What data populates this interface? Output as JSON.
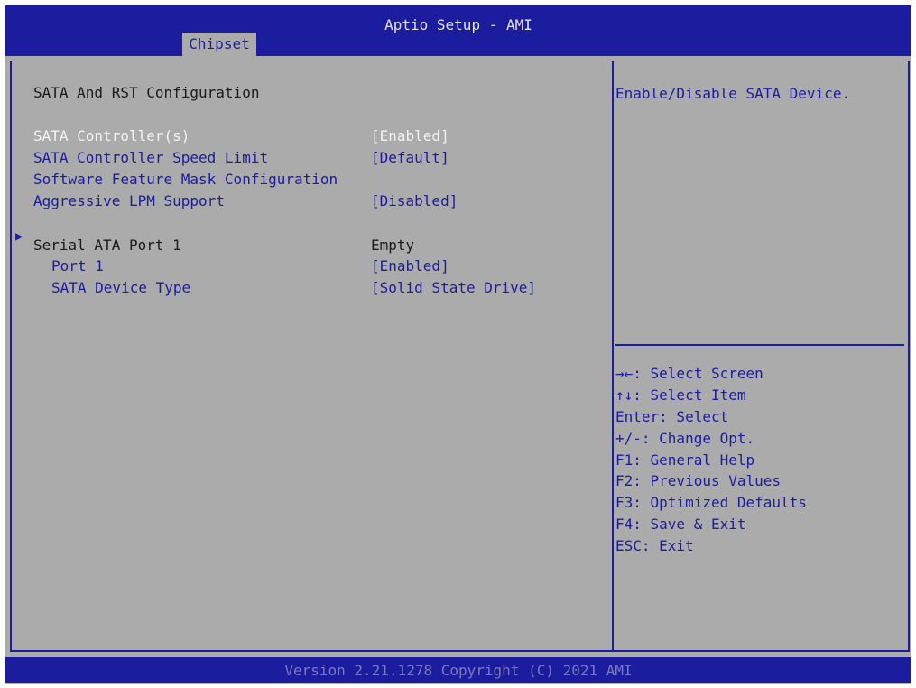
{
  "header": {
    "title": "Aptio Setup - AMI",
    "tab": "Chipset"
  },
  "page_title": "SATA And RST Configuration",
  "items": [
    {
      "label": "SATA Controller(s)",
      "value": "[Enabled]"
    },
    {
      "label": "SATA Controller Speed Limit",
      "value": "[Default]"
    },
    {
      "label": "Software Feature Mask Configuration",
      "value": ""
    },
    {
      "label": "Aggressive LPM Support",
      "value": "[Disabled]"
    }
  ],
  "port_section": {
    "label": "Serial ATA Port 1",
    "value": "Empty"
  },
  "port_items": [
    {
      "label": "Port 1",
      "value": "[Enabled]"
    },
    {
      "label": "SATA Device Type",
      "value": "[Solid State Drive]"
    }
  ],
  "help_text": "Enable/Disable SATA Device.",
  "key_help": [
    "→←: Select Screen",
    "↑↓: Select Item",
    "Enter: Select",
    "+/-: Change Opt.",
    "F1: General Help",
    "F2: Previous Values",
    "F3: Optimized Defaults",
    "F4: Save & Exit",
    "ESC: Exit"
  ],
  "footer": {
    "version": "Version 2.21.1278 Copyright (C) 2021 AMI"
  },
  "submenu_marker_icon": "triangle-right-icon",
  "colors": {
    "bar": "#1c1c9f",
    "background": "#ababab",
    "selected": "#f2f2f2"
  }
}
